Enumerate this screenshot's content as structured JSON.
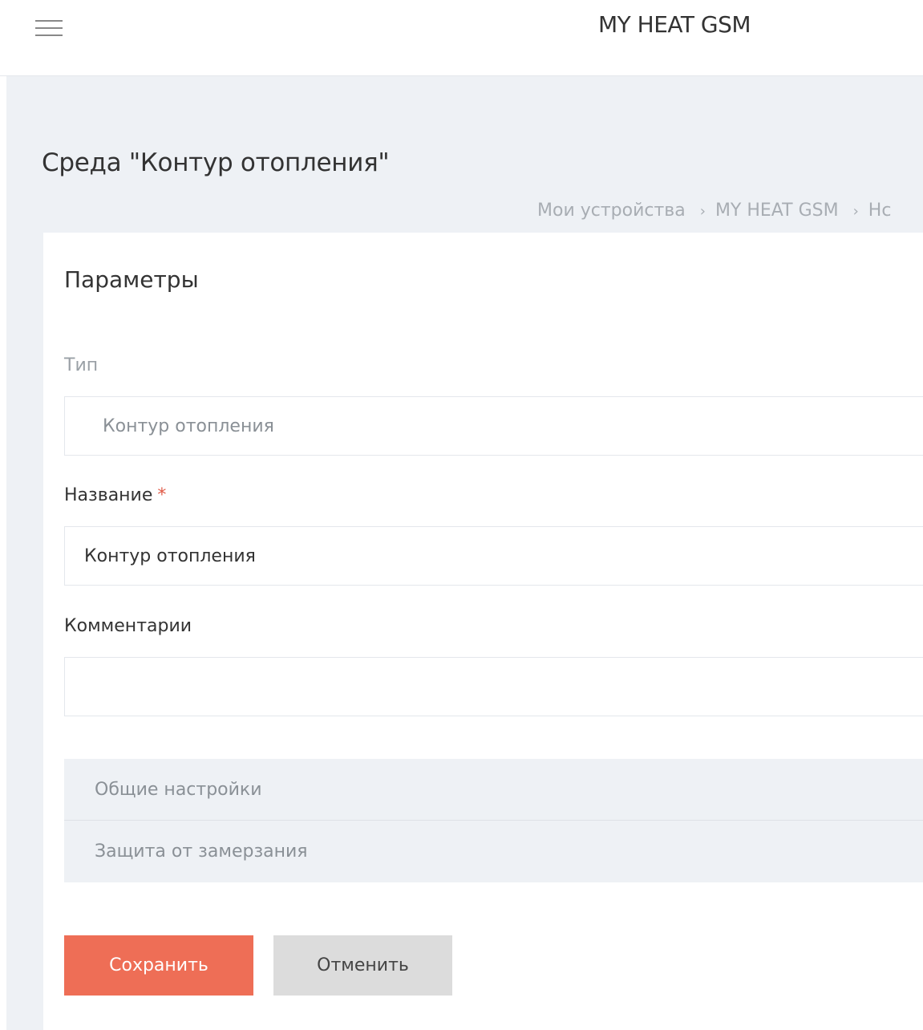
{
  "header": {
    "app_title": "MY HEAT GSM",
    "menu_icon": "hamburger-icon"
  },
  "page": {
    "title": "Среда \"Контур отопления\"",
    "breadcrumb": [
      "Мои устройства",
      "MY HEAT GSM",
      "Нс"
    ],
    "breadcrumb_separator": "›"
  },
  "form": {
    "section_title": "Параметры",
    "type_label": "Тип",
    "type_value": "Контур отопления",
    "name_label": "Название",
    "name_required_mark": "*",
    "name_value": "Контур отопления",
    "comment_label": "Комментарии",
    "comment_value": ""
  },
  "accordion": {
    "items": [
      "Общие настройки",
      "Защита от замерзания"
    ]
  },
  "buttons": {
    "save_label": "Сохранить",
    "cancel_label": "Отменить"
  },
  "colors": {
    "primary": "#ee6e56",
    "secondary_button": "#dcdcdc",
    "page_background": "#eef1f5",
    "required_mark": "#e05a47"
  }
}
